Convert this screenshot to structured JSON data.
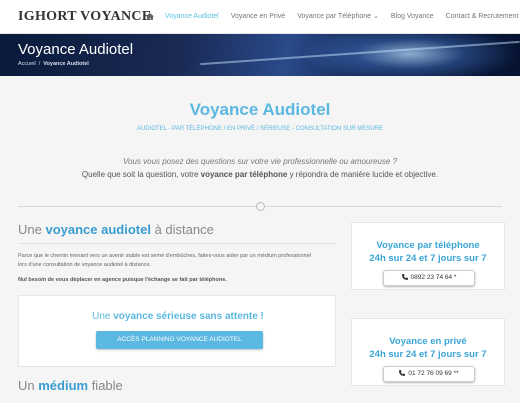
{
  "header": {
    "logo": "IGHORT VOYANCE",
    "nav": [
      "Voyance Audiotel",
      "Voyance en Privé",
      "Voyance par Téléphone",
      "Blog Voyance",
      "Contact & Recrutement"
    ]
  },
  "hero": {
    "title": "Voyance Audiotel",
    "breadcrumb_home": "Accueil",
    "breadcrumb_sep": "/",
    "breadcrumb_current": "Voyance Audiotel"
  },
  "intro": {
    "title": "Voyance Audiotel",
    "subtitle": "AUDIOTEL - PAR TÉLÉPHONE / EN PRIVÉ / SÉRIEUSE - CONSULTATION SUR MESURE",
    "question": "Vous vous posez des questions sur votre vie professionnelle ou amoureuse ?",
    "answer_start": "Quelle que soit la question, votre ",
    "answer_bold": "voyance par téléphone",
    "answer_end": " y répondra de manière lucide et objective."
  },
  "section1": {
    "heading_pre": "Une ",
    "heading_bold": "voyance audiotel",
    "heading_post": " à distance",
    "paragraph": "Parce que le chemin menant vers un avenir stable est semé d'embûches, faites-vous aider par un médium professionnel lors d'une consultation de voyance audiotel à distance.",
    "bold_line": "Nul besoin de vous déplacer en agence puisque l'échange se fait par téléphone."
  },
  "cta": {
    "title_pre": "Une ",
    "title_bold": "voyance sérieuse sans attente !",
    "button": "ACCÈS PLANNING VOYANCE AUDIOTEL"
  },
  "section2": {
    "heading_pre": "Un ",
    "heading_bold": "médium",
    "heading_post": " fiable"
  },
  "cards": [
    {
      "title": "Voyance par téléphone",
      "hours": "24h sur 24 et 7 jours sur 7",
      "phone": "0892 23 74 64 *"
    },
    {
      "title": "Voyance en privé",
      "hours": "24h sur 24 et 7 jours sur 7",
      "phone": "01 72 76 09 69 **"
    }
  ],
  "colors": {
    "accent": "#5bb8e0",
    "heading_blue": "#3a9dd0"
  }
}
